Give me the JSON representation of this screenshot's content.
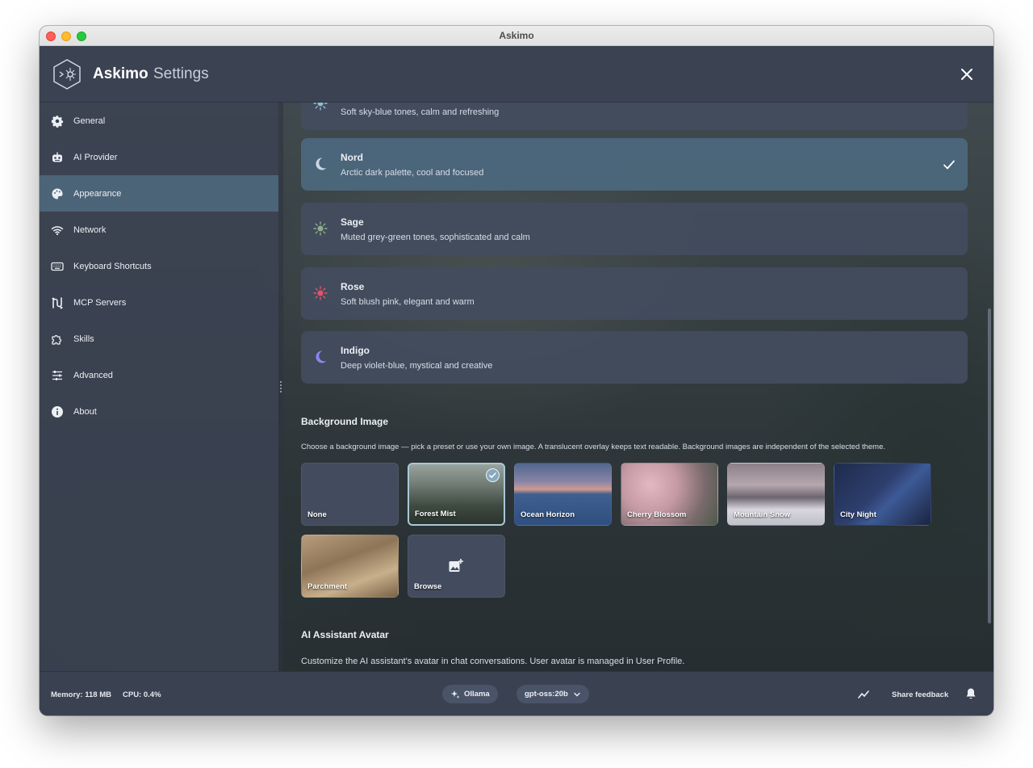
{
  "window": {
    "title": "Askimo"
  },
  "header": {
    "brand": "Askimo",
    "subtitle": "Settings"
  },
  "sidebar": {
    "items": [
      {
        "label": "General",
        "icon": "gear-icon"
      },
      {
        "label": "AI Provider",
        "icon": "robot-icon"
      },
      {
        "label": "Appearance",
        "icon": "palette-icon",
        "active": true
      },
      {
        "label": "Network",
        "icon": "wifi-icon"
      },
      {
        "label": "Keyboard Shortcuts",
        "icon": "keyboard-icon"
      },
      {
        "label": "MCP Servers",
        "icon": "mcp-icon"
      },
      {
        "label": "Skills",
        "icon": "puzzle-icon"
      },
      {
        "label": "Advanced",
        "icon": "sliders-icon"
      },
      {
        "label": "About",
        "icon": "info-icon"
      }
    ]
  },
  "themes": [
    {
      "name": "",
      "description": "Soft sky-blue tones, calm and refreshing",
      "icon": "sun-icon",
      "color": "#8fbcd4"
    },
    {
      "name": "Nord",
      "description": "Arctic dark palette, cool and focused",
      "icon": "moon-icon",
      "color": "#c9d6e3",
      "selected": true
    },
    {
      "name": "Sage",
      "description": "Muted grey-green tones, sophisticated and calm",
      "icon": "sun-icon",
      "color": "#8fae8a"
    },
    {
      "name": "Rose",
      "description": "Soft blush pink, elegant and warm",
      "icon": "sun-icon",
      "color": "#e5546a"
    },
    {
      "name": "Indigo",
      "description": "Deep violet-blue, mystical and creative",
      "icon": "moon-icon",
      "color": "#8b85f0"
    }
  ],
  "background": {
    "title": "Background Image",
    "description": "Choose a background image — pick a preset or use your own image. A translucent overlay keeps text readable. Background images are independent of the selected theme.",
    "tiles": [
      {
        "label": "None"
      },
      {
        "label": "Forest Mist",
        "selected": true
      },
      {
        "label": "Ocean Horizon"
      },
      {
        "label": "Cherry Blossom"
      },
      {
        "label": "Mountain Snow"
      },
      {
        "label": "City Night"
      },
      {
        "label": "Parchment"
      },
      {
        "label": "Browse",
        "icon": "add-image-icon"
      }
    ]
  },
  "avatar": {
    "title": "AI Assistant Avatar",
    "description": "Customize the AI assistant's avatar in chat conversations. User avatar is managed in User Profile."
  },
  "footer": {
    "memory": "Memory: 118 MB",
    "cpu": "CPU: 0.4%",
    "provider": "Ollama",
    "model": "gpt-oss:20b",
    "feedback": "Share feedback"
  }
}
